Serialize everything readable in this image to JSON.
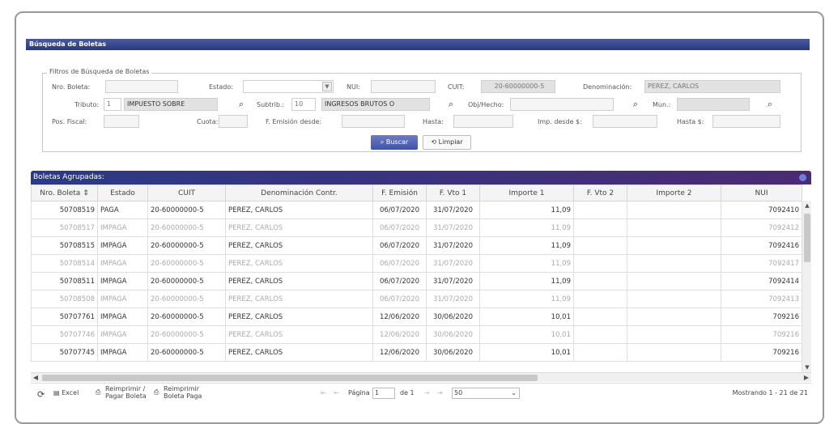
{
  "panel": {
    "title": "Búsqueda de Boletas"
  },
  "filters": {
    "legend": "Filtros de Búsqueda de Boletas",
    "nro_boleta_label": "Nro. Boleta:",
    "estado_label": "Estado:",
    "nui_label": "NUI:",
    "cuit_label": "CUIT:",
    "cuit_value": "20-60000000-5",
    "denominacion_label": "Denominación:",
    "denominacion_value": "PEREZ, CARLOS",
    "tributo_label": "Tributo:",
    "tributo_code": "1",
    "tributo_desc": "IMPUESTO SOBRE",
    "subtrib_label": "Subtrib.:",
    "subtrib_code": "10",
    "subtrib_desc": "INGRESOS BRUTOS O",
    "obj_hecho_label": "Obj/Hecho:",
    "mun_label": "Mun.:",
    "pos_fiscal_label": "Pos. Fiscal:",
    "cuota_label": "Cuota:",
    "f_emision_desde_label": "F. Emisión desde:",
    "hasta_label": "Hasta:",
    "imp_desde_label": "Imp. desde $:",
    "hasta_s_label": "Hasta $:",
    "buscar_label": "Buscar",
    "limpiar_label": "Limpiar"
  },
  "grid": {
    "title": "Boletas Agrupadas:",
    "columns": [
      "Nro. Boleta",
      "Estado",
      "CUIT",
      "Denominación Contr.",
      "F. Emisión",
      "F. Vto 1",
      "Importe 1",
      "F. Vto 2",
      "Importe 2",
      "NUI"
    ],
    "rows": [
      {
        "nro": "50708519",
        "estado": "PAGA",
        "cuit": "20-60000000-5",
        "denom": "PEREZ, CARLOS",
        "emision": "06/07/2020",
        "vto1": "31/07/2020",
        "imp1": "11,09",
        "vto2": "",
        "imp2": "",
        "nui": "7092410",
        "faded": false
      },
      {
        "nro": "50708517",
        "estado": "IMPAGA",
        "cuit": "20-60000000-5",
        "denom": "PEREZ, CARLOS",
        "emision": "06/07/2020",
        "vto1": "31/07/2020",
        "imp1": "11,09",
        "vto2": "",
        "imp2": "",
        "nui": "7092412",
        "faded": true
      },
      {
        "nro": "50708515",
        "estado": "IMPAGA",
        "cuit": "20-60000000-5",
        "denom": "PEREZ, CARLOS",
        "emision": "06/07/2020",
        "vto1": "31/07/2020",
        "imp1": "11,09",
        "vto2": "",
        "imp2": "",
        "nui": "7092416",
        "faded": false
      },
      {
        "nro": "50708514",
        "estado": "IMPAGA",
        "cuit": "20-60000000-5",
        "denom": "PEREZ, CARLOS",
        "emision": "06/07/2020",
        "vto1": "31/07/2020",
        "imp1": "11,09",
        "vto2": "",
        "imp2": "",
        "nui": "7092417",
        "faded": true
      },
      {
        "nro": "50708511",
        "estado": "IMPAGA",
        "cuit": "20-60000000-5",
        "denom": "PEREZ, CARLOS",
        "emision": "06/07/2020",
        "vto1": "31/07/2020",
        "imp1": "11,09",
        "vto2": "",
        "imp2": "",
        "nui": "7092414",
        "faded": false
      },
      {
        "nro": "50708508",
        "estado": "IMPAGA",
        "cuit": "20-60000000-5",
        "denom": "PEREZ, CARLOS",
        "emision": "06/07/2020",
        "vto1": "31/07/2020",
        "imp1": "11,09",
        "vto2": "",
        "imp2": "",
        "nui": "7092413",
        "faded": true
      },
      {
        "nro": "50707761",
        "estado": "IMPAGA",
        "cuit": "20-60000000-5",
        "denom": "PEREZ, CARLOS",
        "emision": "12/06/2020",
        "vto1": "30/06/2020",
        "imp1": "10,01",
        "vto2": "",
        "imp2": "",
        "nui": "709216",
        "faded": false
      },
      {
        "nro": "50707746",
        "estado": "IMPAGA",
        "cuit": "20-60000000-5",
        "denom": "PEREZ, CARLOS",
        "emision": "12/06/2020",
        "vto1": "30/06/2020",
        "imp1": "10,01",
        "vto2": "",
        "imp2": "",
        "nui": "709216",
        "faded": true
      },
      {
        "nro": "50707745",
        "estado": "IMPAGA",
        "cuit": "20-60000000-5",
        "denom": "PEREZ, CARLOS",
        "emision": "12/06/2020",
        "vto1": "30/06/2020",
        "imp1": "10,01",
        "vto2": "",
        "imp2": "",
        "nui": "709216",
        "faded": false
      }
    ]
  },
  "footer": {
    "excel_label": "Excel",
    "reimprimir_pagar_l1": "Reimprimir /",
    "reimprimir_pagar_l2": "Pagar Boleta",
    "reimprimir_paga_l1": "Reimprimir",
    "reimprimir_paga_l2": "Boleta Paga",
    "pagina_label": "Página",
    "page_value": "1",
    "de_label": "de 1",
    "page_size": "50",
    "mostrando": "Mostrando 1 - 21 de 21"
  }
}
